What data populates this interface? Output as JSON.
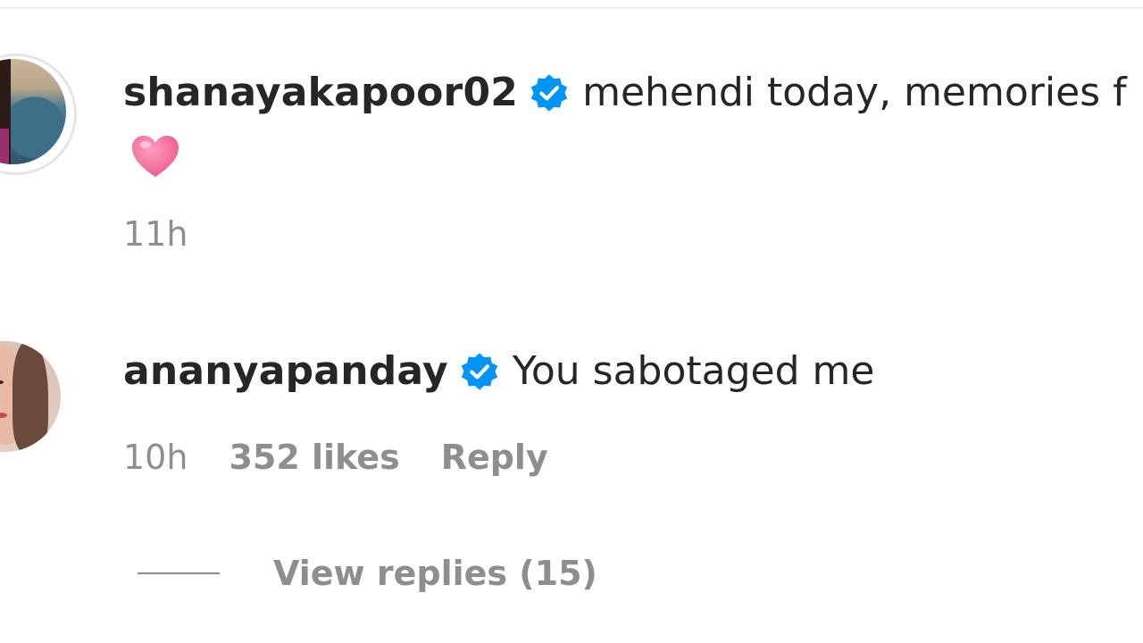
{
  "caption": {
    "username": "shanayakapoor02",
    "text": "mehendi today, memories f",
    "emoji": "pink-heart",
    "timestamp": "11h"
  },
  "comment": {
    "username": "ananyapanday",
    "text": "You sabotaged me",
    "timestamp": "10h",
    "likes": "352 likes",
    "reply_label": "Reply"
  },
  "replies": {
    "label": "View replies (15)"
  },
  "colors": {
    "text": "#262626",
    "secondary": "#8e8e8e",
    "verified": "#0095f6",
    "heart": "#f06a98"
  },
  "icons": {
    "verified": "verified-badge-icon",
    "heart": "pink-heart-icon"
  }
}
